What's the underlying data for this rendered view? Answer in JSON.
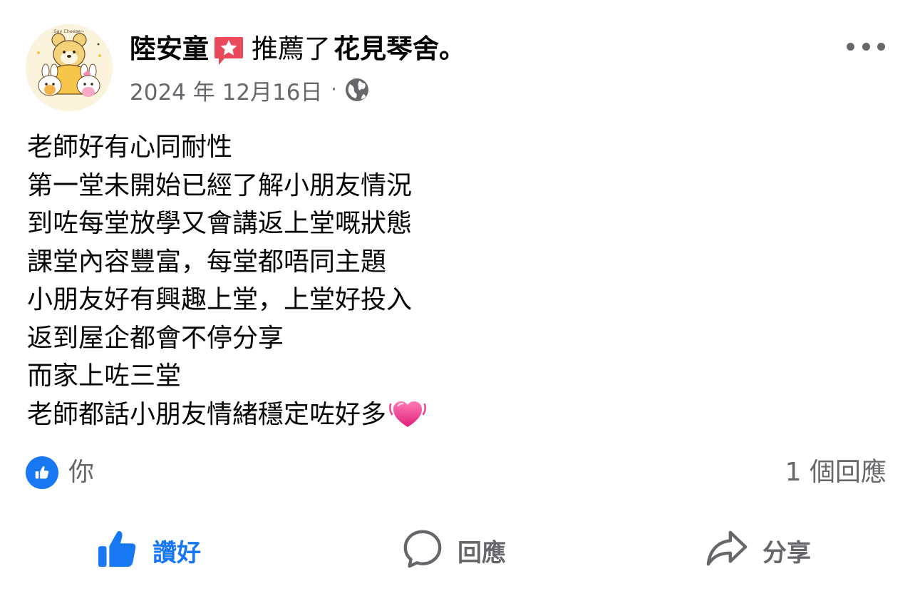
{
  "post": {
    "author_name": "陸安童",
    "action_text": "推薦了",
    "page_name": "花見琴舍。",
    "date": "2024 年 12月16日",
    "separator": "·",
    "audience_icon": "globe-icon",
    "recommend_icon": "recommend-star-icon",
    "more_icon": "more-dots-icon",
    "avatar_caption": "Say Cheese~",
    "body_lines": [
      "老師好有心同耐性",
      "第一堂未開始已經了解小朋友情況",
      "到咗每堂放學又會講返上堂嘅狀態",
      "課堂內容豐富，每堂都唔同主題",
      "小朋友好有興趣上堂，上堂好投入",
      "返到屋企都會不停分享",
      "而家上咗三堂",
      "老師都話小朋友情緒穩定咗好多"
    ],
    "trailing_emoji": "heart-icon"
  },
  "reactions": {
    "reactor": "你",
    "comment_count": "1 個回應"
  },
  "actions": {
    "like_label": "讚好",
    "comment_label": "回應",
    "share_label": "分享",
    "like_active": true
  },
  "colors": {
    "accent": "#1877f2",
    "secondary_text": "#65676b",
    "recommend_red": "#e94a5b",
    "heart_pink": "#f0408c"
  }
}
